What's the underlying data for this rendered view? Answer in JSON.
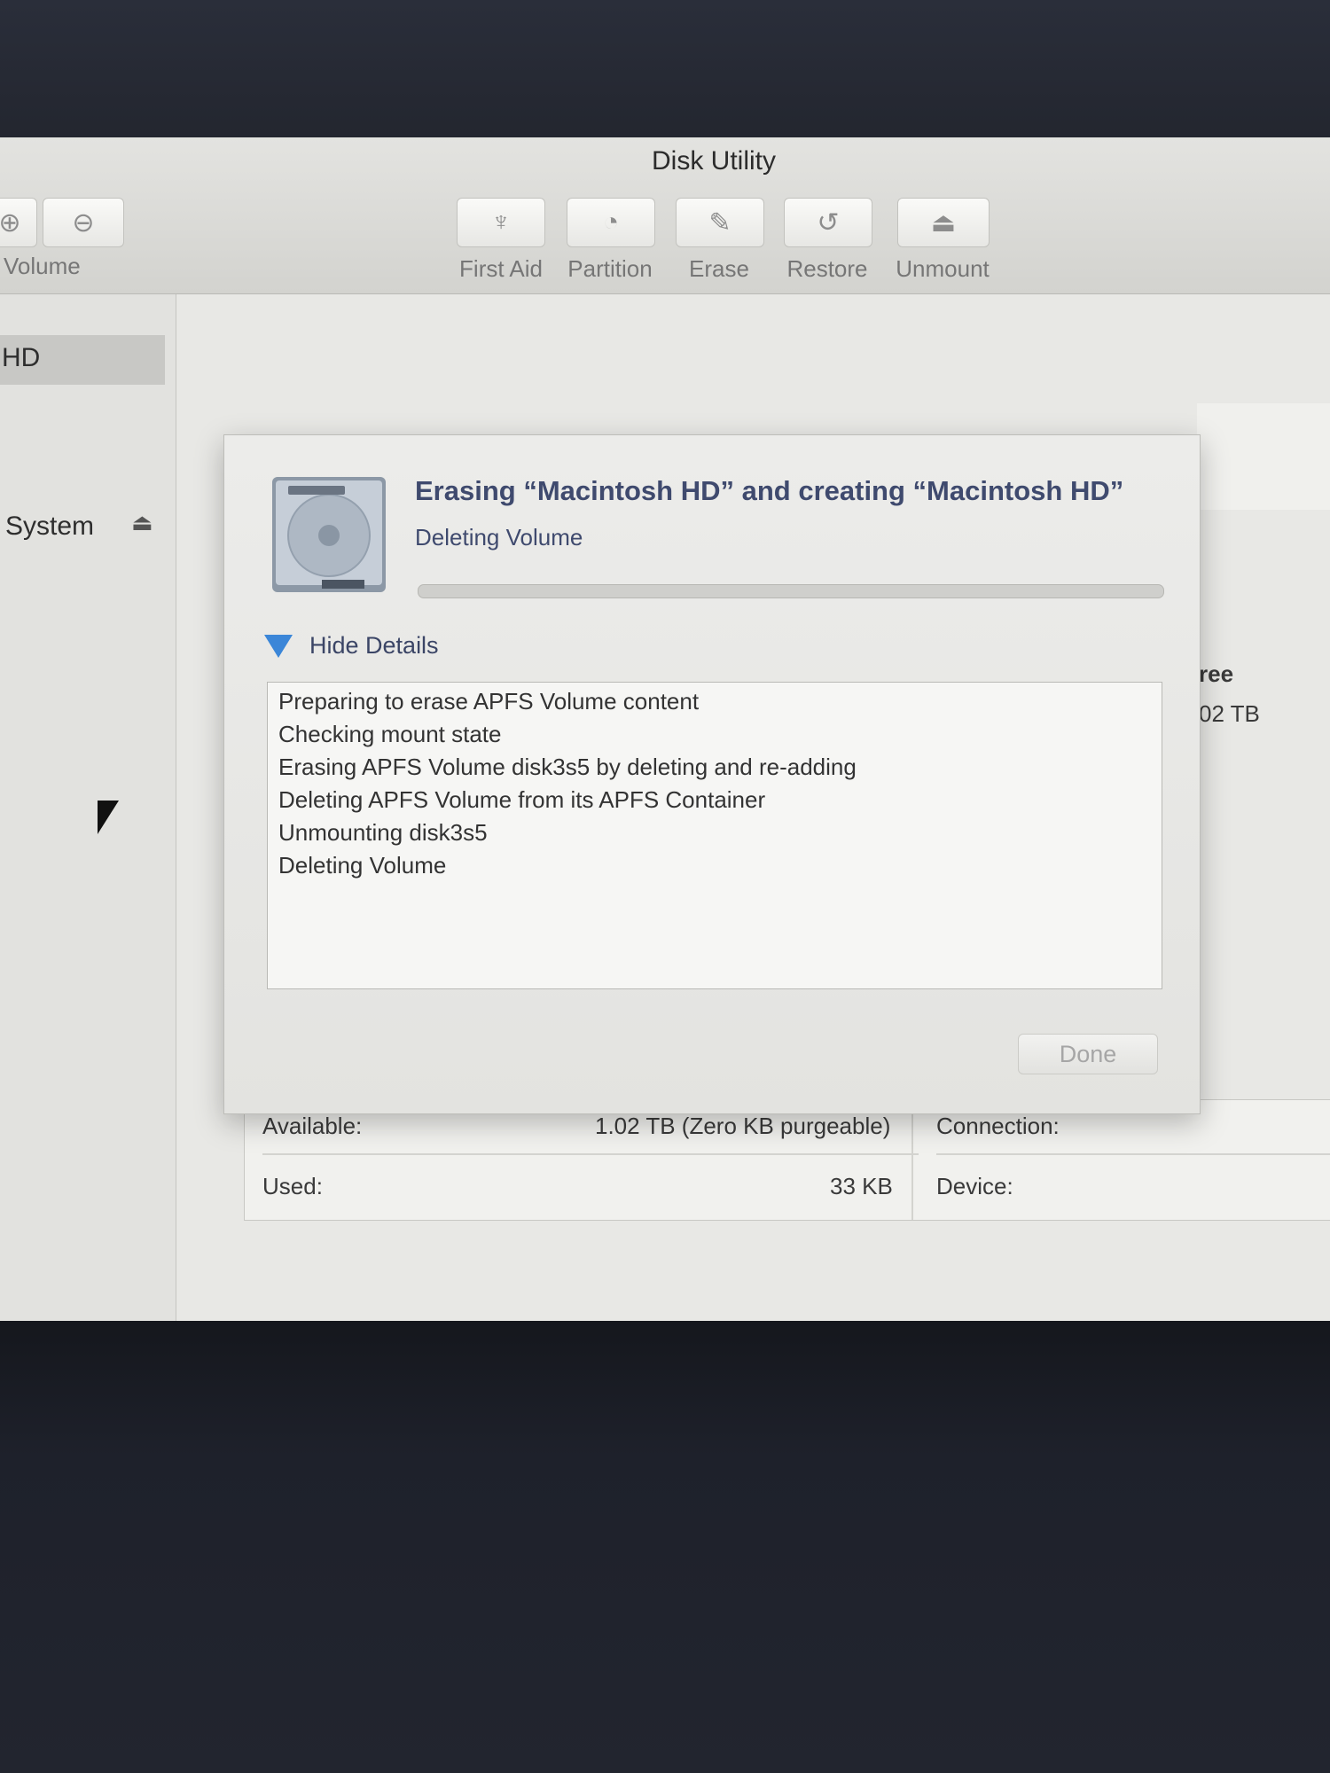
{
  "window": {
    "title": "Disk Utility"
  },
  "toolbar": {
    "left_label": "Volume",
    "buttons": [
      {
        "label": "First Aid",
        "icon": "stethoscope-icon"
      },
      {
        "label": "Partition",
        "icon": "pie-chart-icon"
      },
      {
        "label": "Erase",
        "icon": "pencil-icon"
      },
      {
        "label": "Restore",
        "icon": "restore-arrow-icon"
      },
      {
        "label": "Unmount",
        "icon": "eject-icon"
      }
    ]
  },
  "sidebar": {
    "items": [
      {
        "label": "HD",
        "selected": true
      },
      {
        "label": "System"
      }
    ]
  },
  "sheet": {
    "title": "Erasing “Macintosh HD” and creating “Macintosh HD”",
    "status": "Deleting Volume",
    "progress": 0.0,
    "details_toggle": "Hide Details",
    "log": [
      "Preparing to erase APFS Volume content",
      "Checking mount state",
      "Erasing APFS Volume disk3s5 by deleting and re-adding",
      "Deleting APFS Volume from its APFS Container",
      "Unmounting disk3s5",
      "Deleting Volume"
    ],
    "done_label": "Done"
  },
  "info": {
    "free_header": "ree",
    "free_value": "02 TB",
    "available_label": "Available:",
    "available_value": "1.02 TB (Zero KB purgeable)",
    "used_label": "Used:",
    "used_value": "33 KB",
    "connection_label": "Connection:",
    "device_label": "Device:"
  }
}
